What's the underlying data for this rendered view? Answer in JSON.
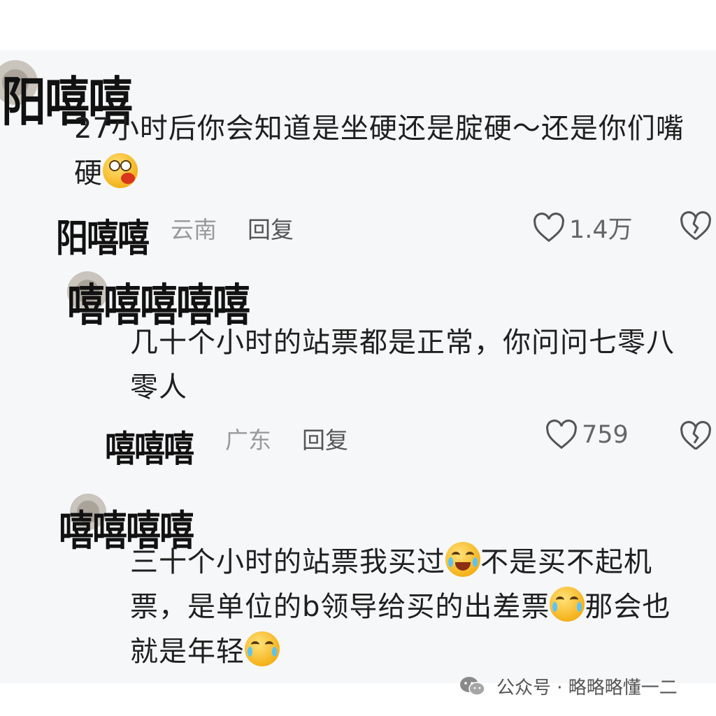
{
  "comments": [
    {
      "username": "阳嘻嘻",
      "text_lines": [
        "27小时后你会知道是坐硬还是腚硬～还是你们嘴",
        "硬"
      ],
      "emoji": "vomit-face-emoji",
      "location": "云南",
      "reply_label": "回复",
      "likes": "1.4万"
    },
    {
      "username": "嘻嘻嘻嘻嘻",
      "text_lines": [
        "几十个小时的站票都是正常，你问问七零八",
        "零人"
      ],
      "location": "广东",
      "reply_label": "回复",
      "likes": "759"
    },
    {
      "username": "嘻嘻嘻嘻",
      "text_lines": [
        "三十个小时的站票我买过",
        "不是买不起机",
        "票，是单位的b领导给买的出差票",
        "那会也",
        "就是年轻"
      ],
      "emojis": [
        "laughing-crying-emoji",
        "crying-face-emoji",
        "crying-face-emoji"
      ]
    }
  ],
  "watermark": {
    "text": "公众号 · 略略略懂一二",
    "icon": "wechat-icon"
  },
  "colors": {
    "background": "#f6f7f9",
    "text": "#1f1f1f",
    "meta": "#9a9a9a"
  }
}
